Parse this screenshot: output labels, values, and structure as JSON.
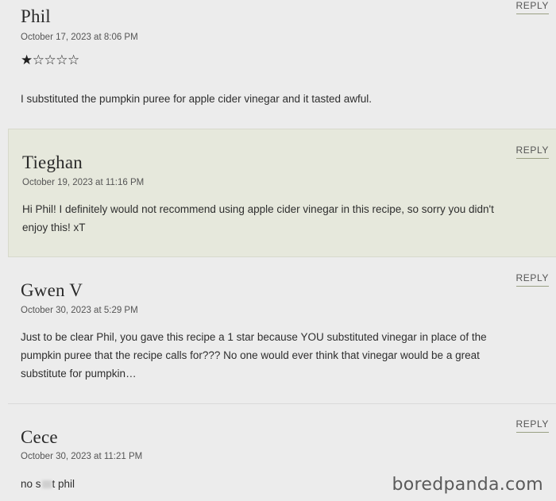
{
  "comments": [
    {
      "name": "Phil",
      "date": "October 17, 2023 at 8:06 PM",
      "rating": 1,
      "rating_max": 5,
      "text": "I substituted the pumpkin puree for apple cider vinegar and it tasted awful.",
      "reply_label": "REPLY"
    },
    {
      "name": "Tieghan",
      "date": "October 19, 2023 at 11:16 PM",
      "text_line1": "Hi Phil! I definitely would not recommend using apple cider vinegar in this recipe, so sorry you didn't",
      "text_line2": "enjoy this! xT",
      "reply_label": "REPLY"
    },
    {
      "name": "Gwen V",
      "date": "October 30, 2023 at 5:29 PM",
      "text_line1": "Just to be clear Phil, you gave this recipe a 1 star because YOU substituted vinegar in place of the",
      "text_line2": "pumpkin puree that the recipe calls for??? No one would ever think that vinegar would be a great",
      "text_line3": "substitute for pumpkin…",
      "reply_label": "REPLY"
    },
    {
      "name": "Cece",
      "date": "October 30, 2023 at 11:21 PM",
      "text_pre": "no s",
      "text_post": "t phil",
      "reply_label": "REPLY"
    }
  ],
  "watermark": "boredpanda.com"
}
